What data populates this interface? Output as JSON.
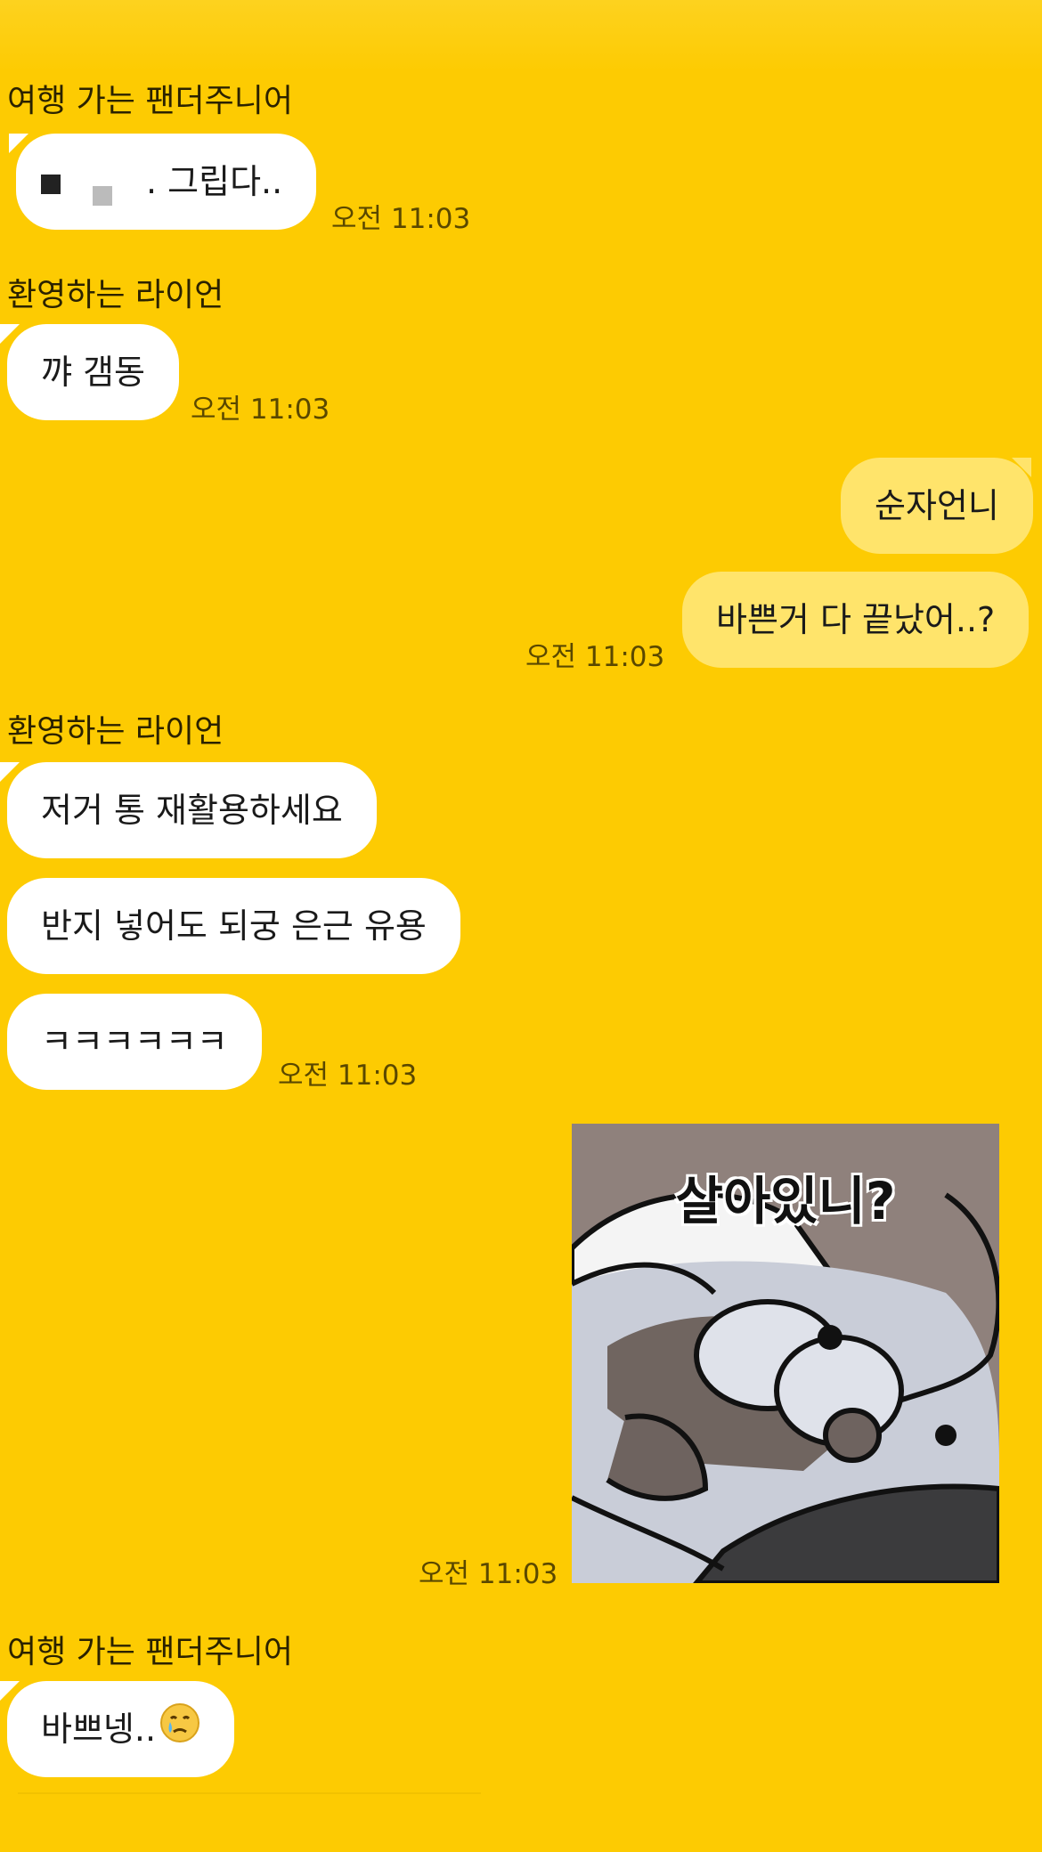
{
  "messages": [
    {
      "sender": "여행 가는 팬더주니어",
      "text": ". 그립다..",
      "time": "오전 11:03"
    },
    {
      "sender": "환영하는 라이언",
      "text": "꺄 갬동",
      "time": "오전 11:03"
    },
    {
      "me_texts": [
        "순자언니",
        "바쁜거 다 끝났어..?"
      ],
      "time": "오전 11:03"
    },
    {
      "sender": "환영하는 라이언",
      "texts": [
        "저거 통 재활용하세요",
        "반지 넣어도 되궁 은근 유용",
        "ㅋㅋㅋㅋㅋㅋ"
      ],
      "time": "오전 11:03"
    },
    {
      "sticker_caption": "살아있니?",
      "sticker_icon": "sleepy-puppy-sticker",
      "time": "오전 11:03"
    },
    {
      "sender": "여행 가는 팬더주니어",
      "text": "바쁘넹..",
      "emoji": "crying-face-emoji"
    }
  ],
  "colors": {
    "background": "#FDCB02",
    "incoming_bubble": "#FFFFFF",
    "outgoing_bubble": "#FFE46B"
  }
}
